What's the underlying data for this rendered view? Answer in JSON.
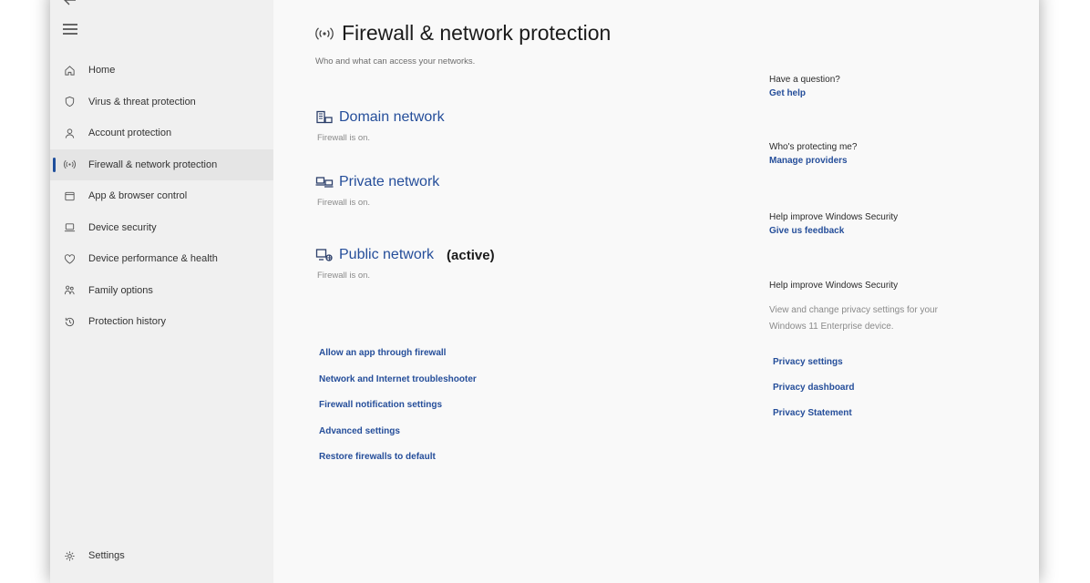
{
  "sidebar": {
    "back_icon": "back-arrow-icon",
    "menu_icon": "hamburger-icon",
    "items": [
      {
        "label": "Home",
        "icon": "home-icon"
      },
      {
        "label": "Virus & threat protection",
        "icon": "shield-icon"
      },
      {
        "label": "Account protection",
        "icon": "person-icon"
      },
      {
        "label": "Firewall & network protection",
        "icon": "wireless-icon",
        "active": true
      },
      {
        "label": "App & browser control",
        "icon": "app-window-icon"
      },
      {
        "label": "Device security",
        "icon": "laptop-icon"
      },
      {
        "label": "Device performance & health",
        "icon": "heart-icon"
      },
      {
        "label": "Family options",
        "icon": "family-icon"
      },
      {
        "label": "Protection history",
        "icon": "history-icon"
      }
    ],
    "settings_label": "Settings"
  },
  "main": {
    "title": "Firewall & network protection",
    "subtitle": "Who and what can access your networks.",
    "networks": [
      {
        "name": "Domain network",
        "status": "Firewall is on.",
        "active_label": ""
      },
      {
        "name": "Private network",
        "status": "Firewall is on.",
        "active_label": ""
      },
      {
        "name": "Public network",
        "status": "Firewall is on.",
        "active_label": "(active)"
      }
    ],
    "links": [
      "Allow an app through firewall",
      "Network and Internet troubleshooter",
      "Firewall notification settings",
      "Advanced settings",
      "Restore firewalls to default"
    ]
  },
  "side": {
    "question_heading": "Have a question?",
    "question_link": "Get help",
    "protecting_heading": "Who's protecting me?",
    "protecting_link": "Manage providers",
    "improve_heading": "Help improve Windows Security",
    "improve_link": "Give us feedback",
    "privacy_heading": "Help improve Windows Security",
    "privacy_desc": "View and change privacy settings for your Windows 11 Enterprise device.",
    "privacy_links": [
      "Privacy settings",
      "Privacy dashboard",
      "Privacy Statement"
    ]
  },
  "colors": {
    "accent": "#254e9a",
    "active_nav_bg": "#e5e5e5",
    "sidebar_bg": "#f0f0f0"
  }
}
